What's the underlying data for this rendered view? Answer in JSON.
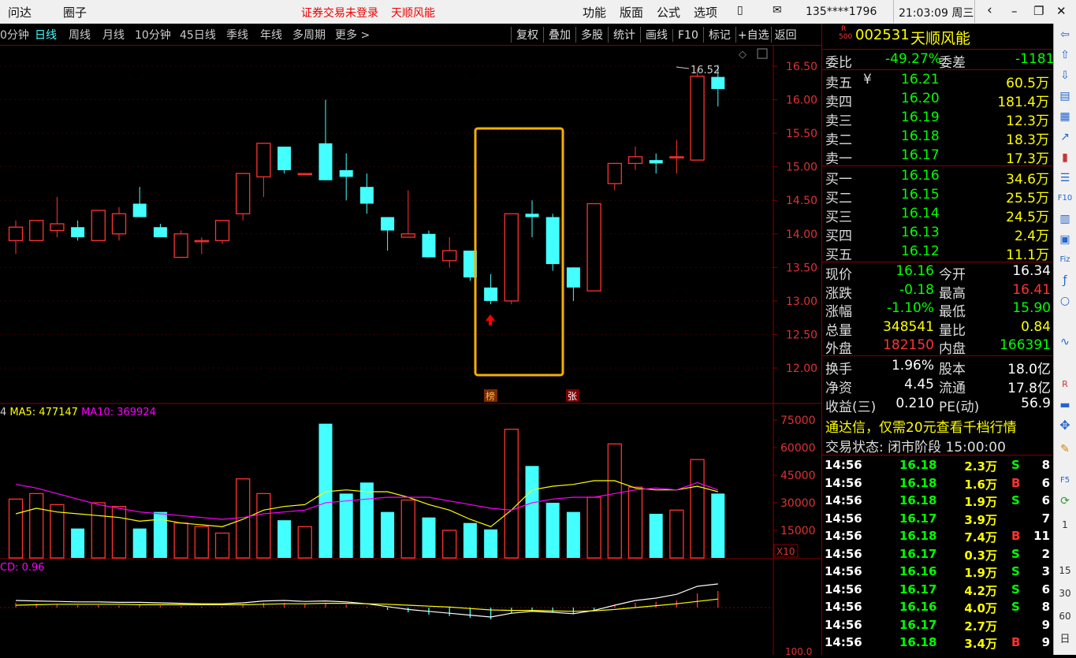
{
  "topbar": {
    "menu_left": [
      "问达",
      "圈子"
    ],
    "notice": "证券交易未登录",
    "stock_name_title": "天顺风能",
    "menu_right": [
      "功能",
      "版面",
      "公式",
      "选项"
    ],
    "account": "135****1796",
    "time": "21:03:09 周三"
  },
  "periods": {
    "tabs": [
      "0分钟",
      "日线",
      "周线",
      "月线",
      "10分钟",
      "45日线",
      "季线",
      "年线",
      "多周期",
      "更多 >"
    ],
    "active": "日线",
    "tools": [
      "复权",
      "叠加",
      "多股",
      "统计",
      "画线",
      "F10",
      "标记",
      "+自选",
      "返回"
    ]
  },
  "chart": {
    "price_ticks": [
      "16.50",
      "16.00",
      "15.50",
      "15.00",
      "14.50",
      "14.00",
      "13.50",
      "13.00",
      "12.50",
      "12.00"
    ],
    "max_label": "16.52",
    "marker_left": "榜",
    "marker_right": "张",
    "vol_legend": "4  MA5: 477147  MA10: 369924",
    "vol_legend_ma5": "MA5: 477147",
    "vol_legend_ma10": "MA10: 369924",
    "vol_ticks": [
      "75000",
      "60000",
      "45000",
      "30000",
      "15000"
    ],
    "vol_unit": "X10",
    "macd_legend": "CD: 0.96",
    "bottom_tick": "100.0"
  },
  "chart_data": {
    "type": "candlestick",
    "ylim": [
      11.7,
      16.7
    ],
    "candles": [
      {
        "o": 13.9,
        "c": 14.1,
        "h": 14.2,
        "l": 13.7
      },
      {
        "o": 13.9,
        "c": 14.2,
        "h": 14.2,
        "l": 13.9
      },
      {
        "o": 14.05,
        "c": 14.15,
        "h": 14.55,
        "l": 13.95
      },
      {
        "o": 14.1,
        "c": 13.95,
        "h": 14.2,
        "l": 13.9
      },
      {
        "o": 13.9,
        "c": 14.35,
        "h": 14.35,
        "l": 13.9
      },
      {
        "o": 14.0,
        "c": 14.3,
        "h": 14.4,
        "l": 13.9
      },
      {
        "o": 14.45,
        "c": 14.25,
        "h": 14.7,
        "l": 14.25
      },
      {
        "o": 14.1,
        "c": 13.95,
        "h": 14.15,
        "l": 13.95
      },
      {
        "o": 13.65,
        "c": 14.0,
        "h": 14.05,
        "l": 13.65
      },
      {
        "o": 13.9,
        "c": 13.9,
        "h": 13.95,
        "l": 13.7
      },
      {
        "o": 13.9,
        "c": 14.2,
        "h": 14.2,
        "l": 13.85
      },
      {
        "o": 14.3,
        "c": 14.9,
        "h": 14.9,
        "l": 14.2
      },
      {
        "o": 14.85,
        "c": 15.35,
        "h": 15.35,
        "l": 14.55
      },
      {
        "o": 15.3,
        "c": 14.95,
        "h": 15.3,
        "l": 14.9
      },
      {
        "o": 14.9,
        "c": 14.9,
        "h": 14.9,
        "l": 14.9
      },
      {
        "o": 15.35,
        "c": 14.8,
        "h": 16.0,
        "l": 14.8
      },
      {
        "o": 14.95,
        "c": 14.85,
        "h": 15.2,
        "l": 14.5
      },
      {
        "o": 14.7,
        "c": 14.45,
        "h": 14.9,
        "l": 14.3
      },
      {
        "o": 14.25,
        "c": 14.05,
        "h": 14.25,
        "l": 13.75
      },
      {
        "o": 13.95,
        "c": 14.0,
        "h": 14.65,
        "l": 13.95
      },
      {
        "o": 14.0,
        "c": 13.65,
        "h": 14.05,
        "l": 13.65
      },
      {
        "o": 13.6,
        "c": 13.75,
        "h": 13.95,
        "l": 13.5
      },
      {
        "o": 13.75,
        "c": 13.35,
        "h": 13.75,
        "l": 13.3
      },
      {
        "o": 13.2,
        "c": 13.0,
        "h": 13.4,
        "l": 12.95
      },
      {
        "o": 13.0,
        "c": 14.3,
        "h": 14.3,
        "l": 12.95
      },
      {
        "o": 14.3,
        "c": 14.25,
        "h": 14.5,
        "l": 13.95
      },
      {
        "o": 14.25,
        "c": 13.55,
        "h": 14.3,
        "l": 13.45
      },
      {
        "o": 13.5,
        "c": 13.2,
        "h": 13.5,
        "l": 13.0
      },
      {
        "o": 13.15,
        "c": 14.45,
        "h": 14.45,
        "l": 13.15
      },
      {
        "o": 14.75,
        "c": 15.05,
        "h": 15.05,
        "l": 14.65
      },
      {
        "o": 15.05,
        "c": 15.15,
        "h": 15.3,
        "l": 14.95
      },
      {
        "o": 15.1,
        "c": 15.05,
        "h": 15.2,
        "l": 14.9
      },
      {
        "o": 15.15,
        "c": 15.15,
        "h": 15.4,
        "l": 14.9
      },
      {
        "o": 15.1,
        "c": 16.35,
        "h": 16.45,
        "l": 15.1
      },
      {
        "o": 16.34,
        "c": 16.16,
        "h": 16.52,
        "l": 15.9
      }
    ],
    "volume": [
      32000,
      35000,
      29000,
      16000,
      30000,
      28000,
      16000,
      25000,
      19000,
      17000,
      13500,
      43000,
      35000,
      20500,
      17000,
      73000,
      35000,
      41000,
      25000,
      31500,
      22000,
      15000,
      19000,
      15500,
      70000,
      50000,
      30000,
      25000,
      33000,
      62000,
      38500,
      24000,
      26000,
      53500,
      35000
    ],
    "ma5_vol": [
      24000,
      27000,
      25000,
      24000,
      23000,
      22000,
      20000,
      21000,
      19000,
      18000,
      17000,
      21000,
      26000,
      28000,
      29000,
      36000,
      37000,
      36000,
      36000,
      33000,
      29000,
      26000,
      21000,
      17000,
      26000,
      37000,
      39000,
      40000,
      42000,
      42000,
      38000,
      37000,
      37000,
      39000,
      36000
    ],
    "ma10_vol": [
      40000,
      38000,
      35000,
      32000,
      29000,
      27000,
      25000,
      24000,
      23000,
      22000,
      21000,
      22000,
      24000,
      25000,
      26000,
      30000,
      31000,
      32000,
      33000,
      33000,
      33000,
      31000,
      29000,
      27000,
      26000,
      30000,
      32000,
      33000,
      33000,
      35000,
      37000,
      38000,
      37000,
      41000,
      37000
    ],
    "macd_hist": [
      0.1,
      0.08,
      0.06,
      0.05,
      0.05,
      0.04,
      0.05,
      0.04,
      0.03,
      0.02,
      0.02,
      0.05,
      0.1,
      0.1,
      0.08,
      0.1,
      0.06,
      0.02,
      -0.05,
      -0.1,
      -0.15,
      -0.18,
      -0.22,
      -0.25,
      -0.12,
      -0.08,
      -0.1,
      -0.14,
      -0.05,
      0.05,
      0.1,
      0.12,
      0.15,
      0.3,
      0.35
    ],
    "macd_dif": [
      0.15,
      0.14,
      0.13,
      0.12,
      0.12,
      0.11,
      0.11,
      0.1,
      0.09,
      0.08,
      0.08,
      0.1,
      0.14,
      0.15,
      0.13,
      0.14,
      0.12,
      0.08,
      0.02,
      -0.04,
      -0.08,
      -0.12,
      -0.16,
      -0.2,
      -0.12,
      -0.08,
      -0.1,
      -0.13,
      -0.06,
      0.05,
      0.15,
      0.2,
      0.28,
      0.45,
      0.5
    ],
    "macd_dea": [
      0.05,
      0.06,
      0.07,
      0.07,
      0.07,
      0.07,
      0.06,
      0.06,
      0.06,
      0.06,
      0.06,
      0.06,
      0.07,
      0.08,
      0.08,
      0.09,
      0.09,
      0.08,
      0.07,
      0.05,
      0.03,
      0.01,
      -0.02,
      -0.05,
      -0.06,
      -0.06,
      -0.07,
      -0.08,
      -0.07,
      -0.04,
      0.0,
      0.04,
      0.08,
      0.13,
      0.18
    ]
  },
  "quote": {
    "code": "002531",
    "name": "天顺风能",
    "r_label": "R",
    "r_sub": "500",
    "weibi_label": "委比",
    "weibi": "-49.27%",
    "weicha_label": "委差",
    "weicha": "-1181",
    "asks": [
      {
        "label": "卖五",
        "price": "16.21",
        "vol": "60.5万"
      },
      {
        "label": "卖四",
        "price": "16.20",
        "vol": "181.4万"
      },
      {
        "label": "卖三",
        "price": "16.19",
        "vol": "12.3万"
      },
      {
        "label": "卖二",
        "price": "16.18",
        "vol": "18.3万"
      },
      {
        "label": "卖一",
        "price": "16.17",
        "vol": "17.3万"
      }
    ],
    "yen": "¥",
    "bids": [
      {
        "label": "买一",
        "price": "16.16",
        "vol": "34.6万"
      },
      {
        "label": "买二",
        "price": "16.15",
        "vol": "25.5万"
      },
      {
        "label": "买三",
        "price": "16.14",
        "vol": "24.5万"
      },
      {
        "label": "买四",
        "price": "16.13",
        "vol": "2.4万"
      },
      {
        "label": "买五",
        "price": "16.12",
        "vol": "11.1万"
      }
    ],
    "stats": [
      {
        "l1": "现价",
        "v1": "16.16",
        "l2": "今开",
        "v2": "16.34"
      },
      {
        "l1": "涨跌",
        "v1": "-0.18",
        "l2": "最高",
        "v2": "16.41"
      },
      {
        "l1": "涨幅",
        "v1": "-1.10%",
        "l2": "最低",
        "v2": "15.90"
      },
      {
        "l1": "总量",
        "v1": "348541",
        "l2": "量比",
        "v2": "0.84"
      },
      {
        "l1": "外盘",
        "v1": "182150",
        "l2": "内盘",
        "v2": "166391"
      }
    ],
    "stats2": [
      {
        "l1": "换手",
        "v1": "1.96%",
        "l2": "股本",
        "v2": "18.0亿"
      },
      {
        "l1": "净资",
        "v1": "4.45",
        "l2": "流通",
        "v2": "17.8亿"
      },
      {
        "l1": "收益(三)",
        "v1": "0.210",
        "l2": "PE(动)",
        "v2": "56.9"
      }
    ],
    "ad": "通达信，仅需20元查看千档行情",
    "status_label": "交易状态:",
    "status_value": "闭市阶段 15:00:00"
  },
  "trades": [
    {
      "time": "14:56",
      "price": "16.18",
      "vol": "2.3万",
      "bs": "S",
      "n": "8"
    },
    {
      "time": "14:56",
      "price": "16.18",
      "vol": "1.6万",
      "bs": "B",
      "n": "6"
    },
    {
      "time": "14:56",
      "price": "16.18",
      "vol": "1.9万",
      "bs": "S",
      "n": "6"
    },
    {
      "time": "14:56",
      "price": "16.17",
      "vol": "3.9万",
      "bs": "",
      "n": "7"
    },
    {
      "time": "14:56",
      "price": "16.18",
      "vol": "7.4万",
      "bs": "B",
      "n": "11"
    },
    {
      "time": "14:56",
      "price": "16.17",
      "vol": "0.3万",
      "bs": "S",
      "n": "2"
    },
    {
      "time": "14:56",
      "price": "16.16",
      "vol": "1.9万",
      "bs": "S",
      "n": "3"
    },
    {
      "time": "14:56",
      "price": "16.17",
      "vol": "4.2万",
      "bs": "S",
      "n": "6"
    },
    {
      "time": "14:56",
      "price": "16.16",
      "vol": "4.0万",
      "bs": "S",
      "n": "8"
    },
    {
      "time": "14:56",
      "price": "16.17",
      "vol": "2.7万",
      "bs": "",
      "n": "9"
    },
    {
      "time": "14:56",
      "price": "16.18",
      "vol": "3.4万",
      "bs": "B",
      "n": "9"
    }
  ],
  "side": {
    "numbers": [
      "1",
      "15",
      "30",
      "60",
      "日"
    ]
  },
  "colors": {
    "up": "#ff3333",
    "down": "#44ffff",
    "highlight": "#f5b000"
  }
}
